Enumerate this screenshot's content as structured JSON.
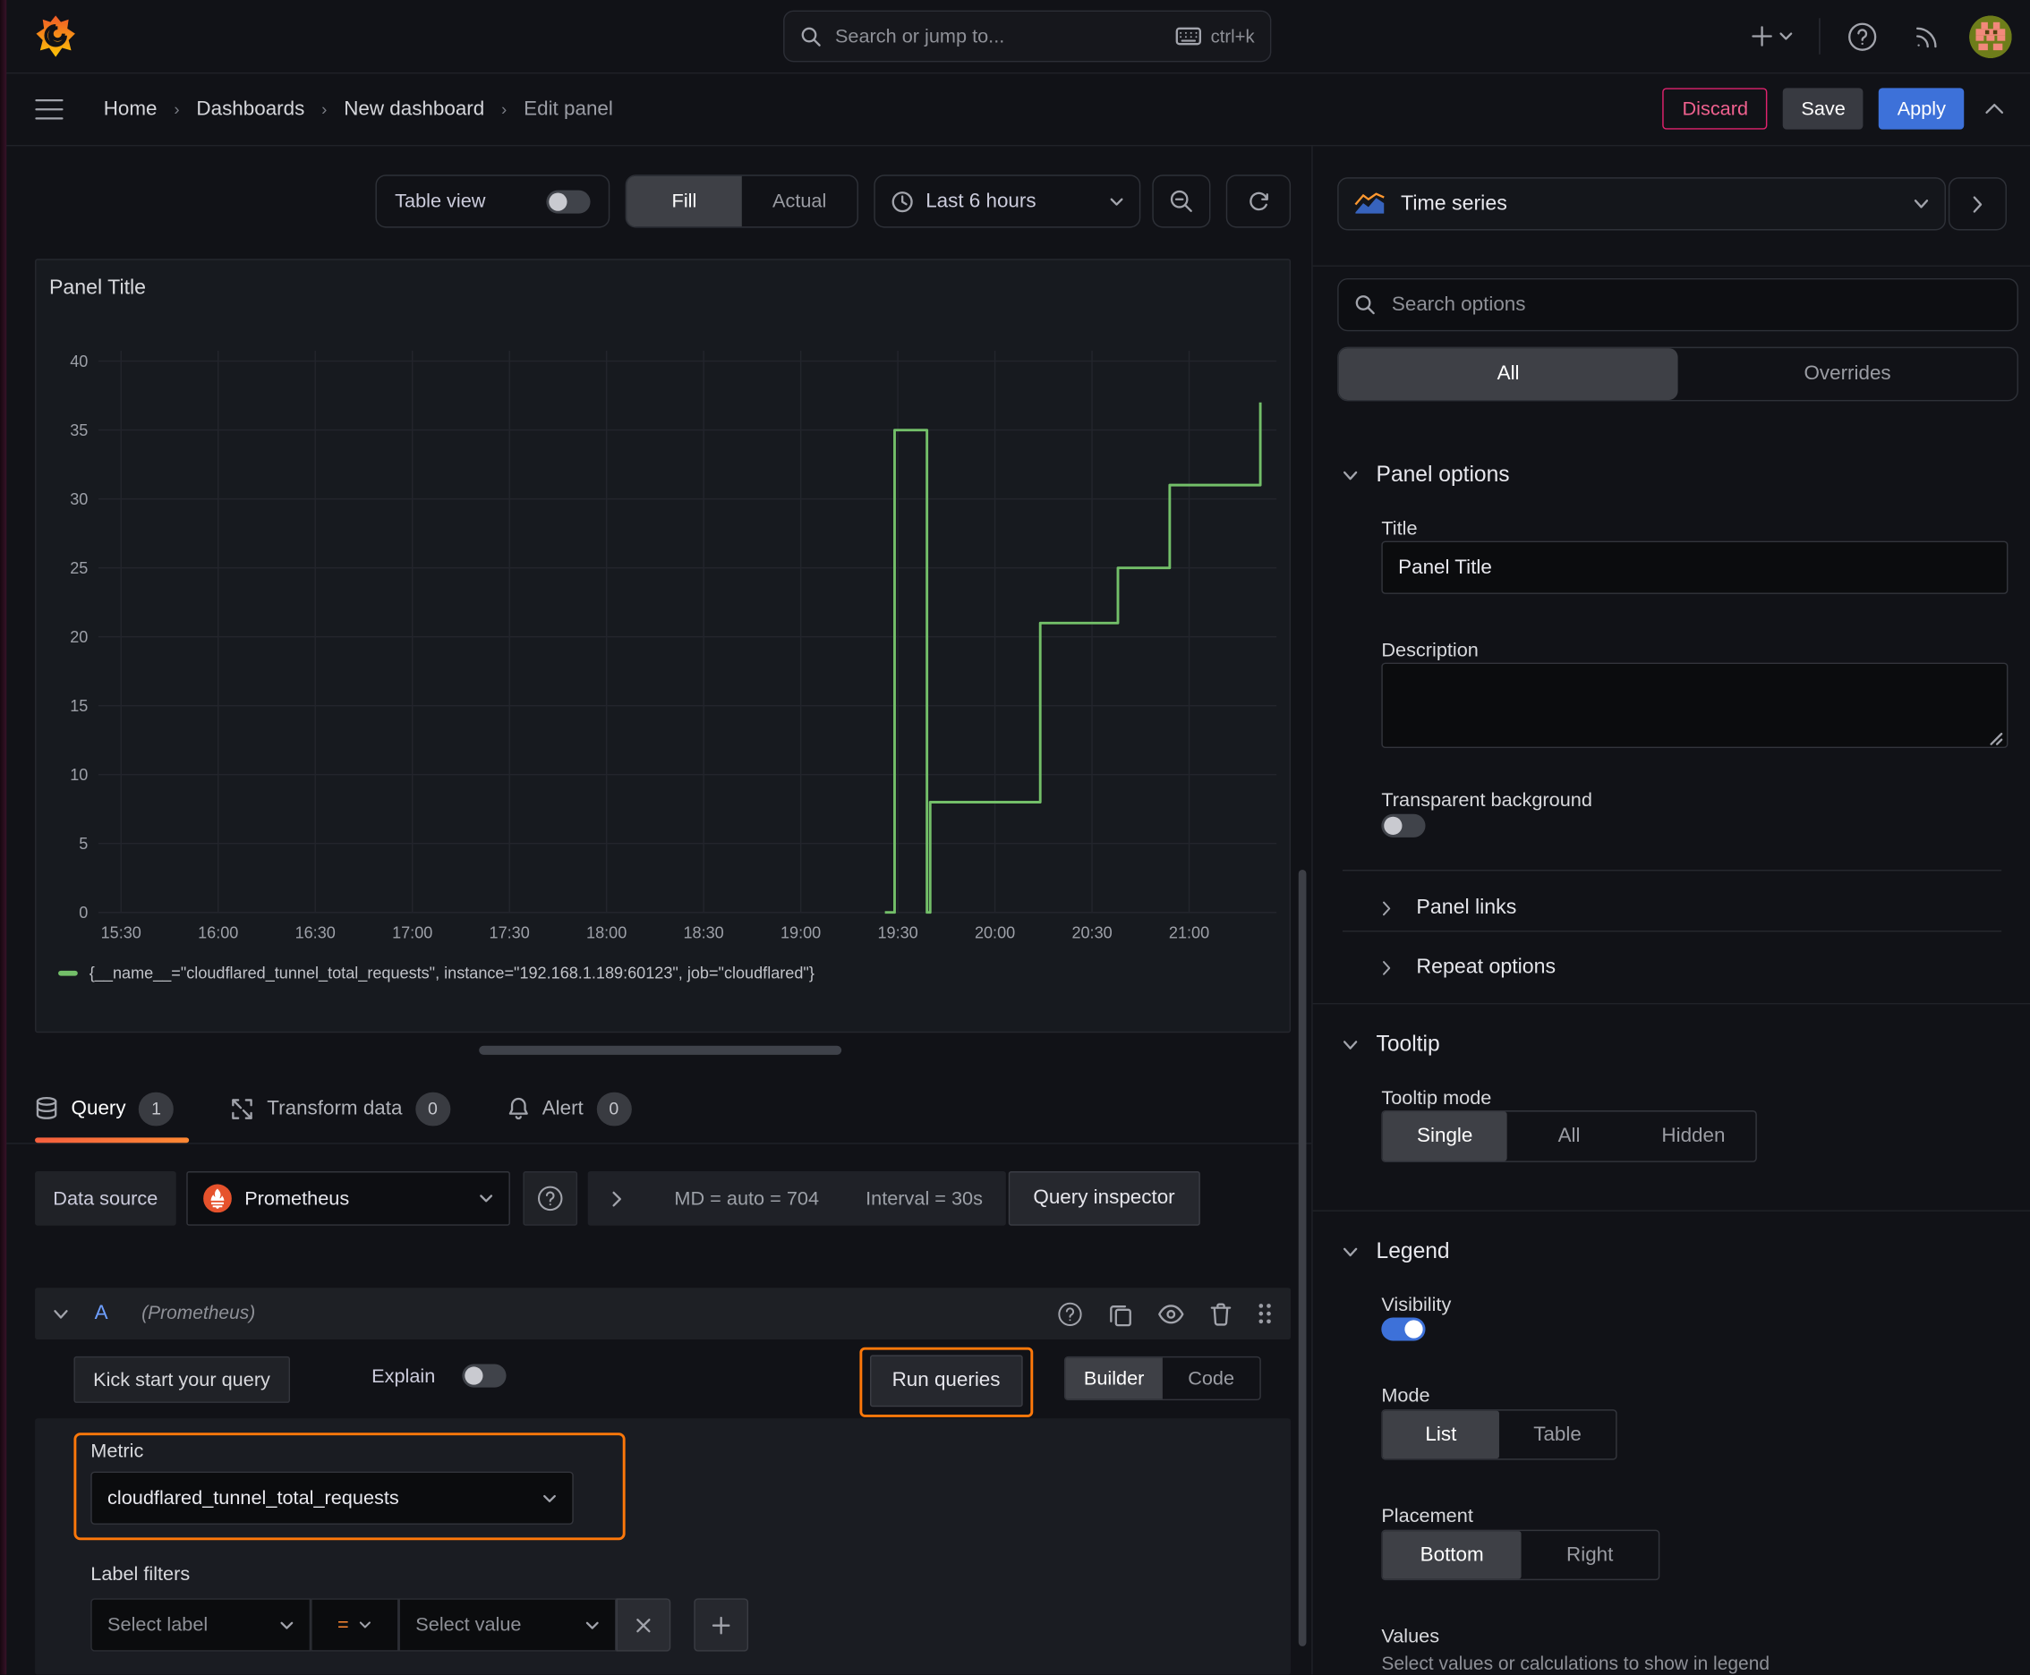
{
  "topnav": {
    "search_placeholder": "Search or jump to...",
    "shortcut": "ctrl+k"
  },
  "breadcrumb": {
    "home": "Home",
    "dashboards": "Dashboards",
    "dashboard": "New dashboard",
    "current": "Edit panel"
  },
  "actions": {
    "discard": "Discard",
    "save": "Save",
    "apply": "Apply"
  },
  "toolbar": {
    "table_view": "Table view",
    "fill": "Fill",
    "actual": "Actual",
    "time_range": "Last 6 hours"
  },
  "viz": {
    "name": "Time series"
  },
  "options": {
    "search_placeholder": "Search options",
    "tab_all": "All",
    "tab_overrides": "Overrides",
    "panel_options": {
      "header": "Panel options",
      "title_label": "Title",
      "title_value": "Panel Title",
      "description_label": "Description",
      "transparent_label": "Transparent background",
      "panel_links": "Panel links",
      "repeat_options": "Repeat options"
    },
    "tooltip": {
      "header": "Tooltip",
      "mode_label": "Tooltip mode",
      "single": "Single",
      "all": "All",
      "hidden": "Hidden",
      "active": "Single"
    },
    "legend": {
      "header": "Legend",
      "visibility_label": "Visibility",
      "mode_label": "Mode",
      "list": "List",
      "table": "Table",
      "active_mode": "List",
      "placement_label": "Placement",
      "bottom": "Bottom",
      "right": "Right",
      "active_placement": "Bottom",
      "values_label": "Values",
      "values_help": "Select values or calculations to show in legend"
    }
  },
  "panel": {
    "title": "Panel Title"
  },
  "query_tabs": {
    "query": "Query",
    "query_count": "1",
    "transform": "Transform data",
    "transform_count": "0",
    "alert": "Alert",
    "alert_count": "0"
  },
  "datasource": {
    "label": "Data source",
    "name": "Prometheus",
    "md": "MD = auto = 704",
    "interval": "Interval = 30s",
    "inspector": "Query inspector"
  },
  "query": {
    "refid": "A",
    "hint": "(Prometheus)",
    "kickstart": "Kick start your query",
    "explain": "Explain",
    "run": "Run queries",
    "builder": "Builder",
    "code": "Code",
    "metric_label": "Metric",
    "metric_value": "cloudflared_tunnel_total_requests",
    "label_filters": "Label filters",
    "select_label": "Select label",
    "operator": "=",
    "select_value": "Select value"
  },
  "colors": {
    "series_green": "#73bf69",
    "highlight_orange": "#ff780a",
    "brand_orange": "#ff8833",
    "tab_underline_from": "#f55f3e",
    "primary_blue": "#3d71d9",
    "danger_pink": "#e0226e",
    "refid_blue": "#6e9fff"
  },
  "chart_data": {
    "type": "line",
    "step": true,
    "grid": true,
    "title": "Panel Title",
    "legend_position": "bottom",
    "x_axis": {
      "tick_labels": [
        "15:30",
        "16:00",
        "16:30",
        "17:00",
        "17:30",
        "18:00",
        "18:30",
        "19:00",
        "19:30",
        "20:00",
        "20:30",
        "21:00"
      ],
      "tick_minutes": [
        0,
        30,
        60,
        90,
        120,
        150,
        180,
        210,
        240,
        270,
        300,
        330
      ],
      "range_minutes": [
        -7,
        357
      ],
      "note": "minutes measured after 15:30"
    },
    "y_axis": {
      "ticks": [
        0,
        5,
        10,
        15,
        20,
        25,
        30,
        35,
        40
      ],
      "range": [
        0,
        40
      ]
    },
    "series": [
      {
        "name": "{__name__=\"cloudflared_tunnel_total_requests\", instance=\"192.168.1.189:60123\", job=\"cloudflared\"}",
        "color": "#73bf69",
        "points": [
          [
            236,
            0
          ],
          [
            239,
            0
          ],
          [
            239,
            35
          ],
          [
            249,
            35
          ],
          [
            249,
            0
          ],
          [
            250,
            0
          ],
          [
            250,
            8
          ],
          [
            284,
            8
          ],
          [
            284,
            21
          ],
          [
            308,
            21
          ],
          [
            308,
            25
          ],
          [
            324,
            25
          ],
          [
            324,
            31
          ],
          [
            352,
            31
          ],
          [
            352,
            37
          ]
        ]
      }
    ]
  }
}
